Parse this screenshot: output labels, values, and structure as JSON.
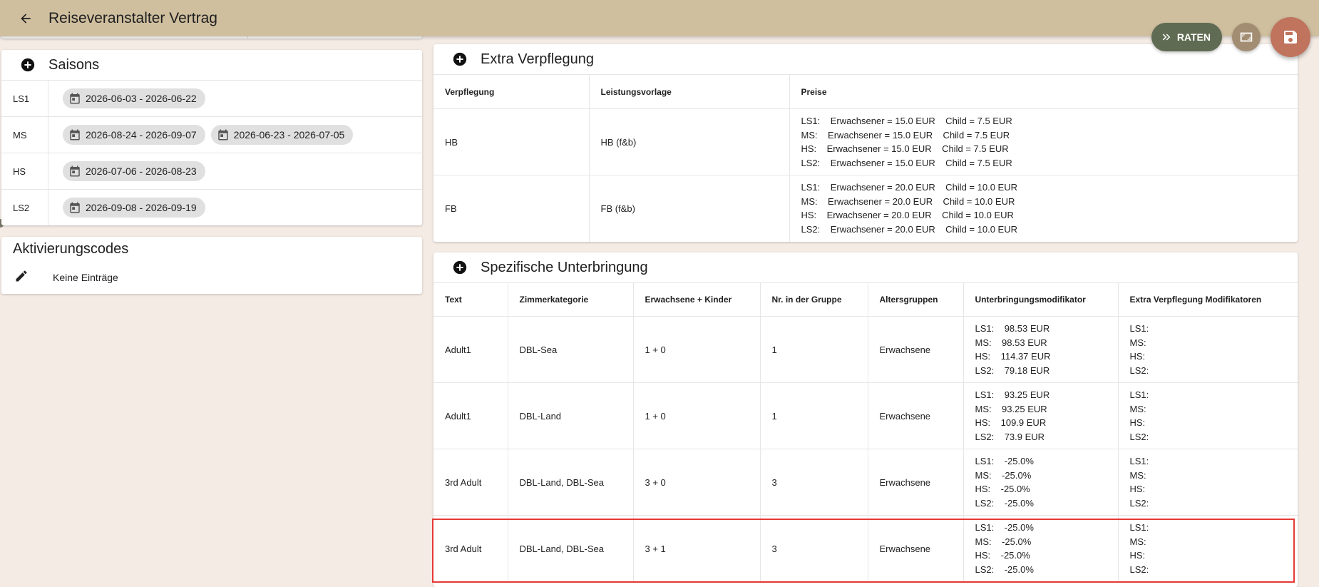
{
  "appbar": {
    "title": "Reiseveranstalter Vertrag"
  },
  "actions": {
    "raten_label": "RATEN"
  },
  "saisons": {
    "title": "Saisons",
    "rows": [
      {
        "code": "LS1",
        "ranges": [
          "2026-06-03 - 2026-06-22"
        ]
      },
      {
        "code": "MS",
        "ranges": [
          "2026-08-24 - 2026-09-07",
          "2026-06-23 - 2026-07-05"
        ]
      },
      {
        "code": "HS",
        "ranges": [
          "2026-07-06 - 2026-08-23"
        ]
      },
      {
        "code": "LS2",
        "ranges": [
          "2026-09-08 - 2026-09-19"
        ]
      }
    ]
  },
  "aktivierungscodes": {
    "title": "Aktivierungscodes",
    "empty_text": "Keine Einträge"
  },
  "extra_verpflegung": {
    "title": "Extra Verpflegung",
    "headers": [
      "Verpflegung",
      "Leistungsvorlage",
      "Preise"
    ],
    "rows": [
      {
        "verpflegung": "HB",
        "vorlage": "HB (f&b)",
        "preise": [
          "LS1:    Erwachsener = 15.0 EUR    Child = 7.5 EUR",
          "MS:    Erwachsener = 15.0 EUR    Child = 7.5 EUR",
          "HS:    Erwachsener = 15.0 EUR    Child = 7.5 EUR",
          "LS2:    Erwachsener = 15.0 EUR    Child = 7.5 EUR"
        ]
      },
      {
        "verpflegung": "FB",
        "vorlage": "FB (f&b)",
        "preise": [
          "LS1:    Erwachsener = 20.0 EUR    Child = 10.0 EUR",
          "MS:    Erwachsener = 20.0 EUR    Child = 10.0 EUR",
          "HS:    Erwachsener = 20.0 EUR    Child = 10.0 EUR",
          "LS2:    Erwachsener = 20.0 EUR    Child = 10.0 EUR"
        ]
      }
    ]
  },
  "spezifische_unterbringung": {
    "title": "Spezifische Unterbringung",
    "headers": [
      "Text",
      "Zimmerkategorie",
      "Erwachsene + Kinder",
      "Nr. in der Gruppe",
      "Altersgruppen",
      "Unterbringungsmodifikator",
      "Extra Verpflegung Modifikatoren"
    ],
    "rows": [
      {
        "text": "Adult1",
        "zimmer": "DBL-Sea",
        "ek": "1 + 0",
        "nr": "1",
        "alter": "Erwachsene",
        "mod": [
          "LS1:    98.53 EUR",
          "MS:    98.53 EUR",
          "HS:    114.37 EUR",
          "LS2:    79.18 EUR"
        ],
        "extra": [
          "LS1:",
          "MS:",
          "HS:",
          "LS2:"
        ]
      },
      {
        "text": "Adult1",
        "zimmer": "DBL-Land",
        "ek": "1 + 0",
        "nr": "1",
        "alter": "Erwachsene",
        "mod": [
          "LS1:    93.25 EUR",
          "MS:    93.25 EUR",
          "HS:    109.9 EUR",
          "LS2:    73.9 EUR"
        ],
        "extra": [
          "LS1:",
          "MS:",
          "HS:",
          "LS2:"
        ]
      },
      {
        "text": "3rd Adult",
        "zimmer": "DBL-Land, DBL-Sea",
        "ek": "3 + 0",
        "nr": "3",
        "alter": "Erwachsene",
        "mod": [
          "LS1:    -25.0%",
          "MS:    -25.0%",
          "HS:    -25.0%",
          "LS2:    -25.0%"
        ],
        "extra": [
          "LS1:",
          "MS:",
          "HS:",
          "LS2:"
        ]
      },
      {
        "text": "3rd Adult",
        "zimmer": "DBL-Land, DBL-Sea",
        "ek": "3 + 1",
        "nr": "3",
        "alter": "Erwachsene",
        "mod": [
          "LS1:    -25.0%",
          "MS:    -25.0%",
          "HS:    -25.0%",
          "LS2:    -25.0%"
        ],
        "extra": [
          "LS1:",
          "MS:",
          "HS:",
          "LS2:"
        ]
      }
    ]
  }
}
